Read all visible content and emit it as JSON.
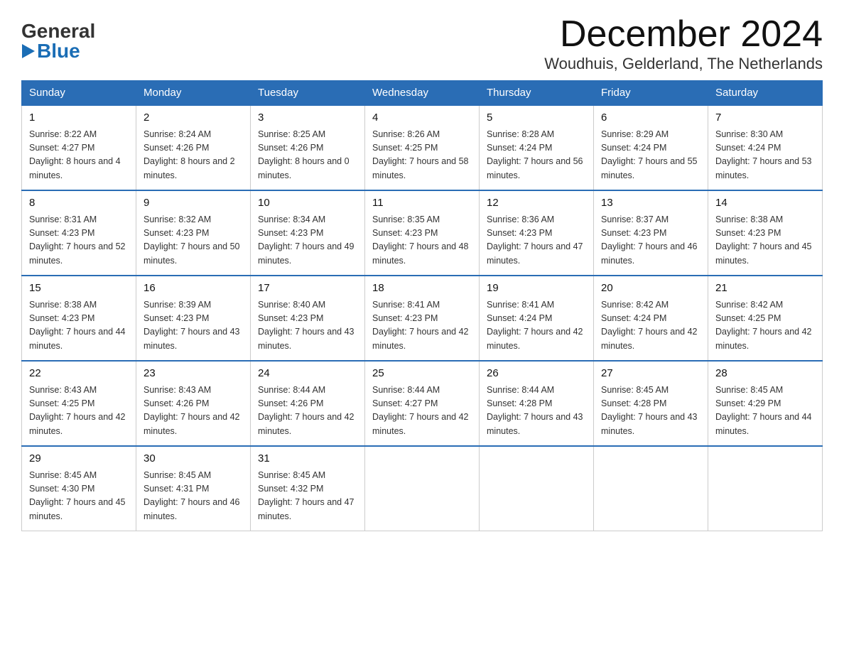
{
  "logo": {
    "general": "General",
    "blue": "Blue",
    "triangle_label": "logo-triangle"
  },
  "header": {
    "month_title": "December 2024",
    "location": "Woudhuis, Gelderland, The Netherlands"
  },
  "weekdays": [
    "Sunday",
    "Monday",
    "Tuesday",
    "Wednesday",
    "Thursday",
    "Friday",
    "Saturday"
  ],
  "weeks": [
    [
      {
        "day": "1",
        "sunrise": "8:22 AM",
        "sunset": "4:27 PM",
        "daylight": "8 hours and 4 minutes."
      },
      {
        "day": "2",
        "sunrise": "8:24 AM",
        "sunset": "4:26 PM",
        "daylight": "8 hours and 2 minutes."
      },
      {
        "day": "3",
        "sunrise": "8:25 AM",
        "sunset": "4:26 PM",
        "daylight": "8 hours and 0 minutes."
      },
      {
        "day": "4",
        "sunrise": "8:26 AM",
        "sunset": "4:25 PM",
        "daylight": "7 hours and 58 minutes."
      },
      {
        "day": "5",
        "sunrise": "8:28 AM",
        "sunset": "4:24 PM",
        "daylight": "7 hours and 56 minutes."
      },
      {
        "day": "6",
        "sunrise": "8:29 AM",
        "sunset": "4:24 PM",
        "daylight": "7 hours and 55 minutes."
      },
      {
        "day": "7",
        "sunrise": "8:30 AM",
        "sunset": "4:24 PM",
        "daylight": "7 hours and 53 minutes."
      }
    ],
    [
      {
        "day": "8",
        "sunrise": "8:31 AM",
        "sunset": "4:23 PM",
        "daylight": "7 hours and 52 minutes."
      },
      {
        "day": "9",
        "sunrise": "8:32 AM",
        "sunset": "4:23 PM",
        "daylight": "7 hours and 50 minutes."
      },
      {
        "day": "10",
        "sunrise": "8:34 AM",
        "sunset": "4:23 PM",
        "daylight": "7 hours and 49 minutes."
      },
      {
        "day": "11",
        "sunrise": "8:35 AM",
        "sunset": "4:23 PM",
        "daylight": "7 hours and 48 minutes."
      },
      {
        "day": "12",
        "sunrise": "8:36 AM",
        "sunset": "4:23 PM",
        "daylight": "7 hours and 47 minutes."
      },
      {
        "day": "13",
        "sunrise": "8:37 AM",
        "sunset": "4:23 PM",
        "daylight": "7 hours and 46 minutes."
      },
      {
        "day": "14",
        "sunrise": "8:38 AM",
        "sunset": "4:23 PM",
        "daylight": "7 hours and 45 minutes."
      }
    ],
    [
      {
        "day": "15",
        "sunrise": "8:38 AM",
        "sunset": "4:23 PM",
        "daylight": "7 hours and 44 minutes."
      },
      {
        "day": "16",
        "sunrise": "8:39 AM",
        "sunset": "4:23 PM",
        "daylight": "7 hours and 43 minutes."
      },
      {
        "day": "17",
        "sunrise": "8:40 AM",
        "sunset": "4:23 PM",
        "daylight": "7 hours and 43 minutes."
      },
      {
        "day": "18",
        "sunrise": "8:41 AM",
        "sunset": "4:23 PM",
        "daylight": "7 hours and 42 minutes."
      },
      {
        "day": "19",
        "sunrise": "8:41 AM",
        "sunset": "4:24 PM",
        "daylight": "7 hours and 42 minutes."
      },
      {
        "day": "20",
        "sunrise": "8:42 AM",
        "sunset": "4:24 PM",
        "daylight": "7 hours and 42 minutes."
      },
      {
        "day": "21",
        "sunrise": "8:42 AM",
        "sunset": "4:25 PM",
        "daylight": "7 hours and 42 minutes."
      }
    ],
    [
      {
        "day": "22",
        "sunrise": "8:43 AM",
        "sunset": "4:25 PM",
        "daylight": "7 hours and 42 minutes."
      },
      {
        "day": "23",
        "sunrise": "8:43 AM",
        "sunset": "4:26 PM",
        "daylight": "7 hours and 42 minutes."
      },
      {
        "day": "24",
        "sunrise": "8:44 AM",
        "sunset": "4:26 PM",
        "daylight": "7 hours and 42 minutes."
      },
      {
        "day": "25",
        "sunrise": "8:44 AM",
        "sunset": "4:27 PM",
        "daylight": "7 hours and 42 minutes."
      },
      {
        "day": "26",
        "sunrise": "8:44 AM",
        "sunset": "4:28 PM",
        "daylight": "7 hours and 43 minutes."
      },
      {
        "day": "27",
        "sunrise": "8:45 AM",
        "sunset": "4:28 PM",
        "daylight": "7 hours and 43 minutes."
      },
      {
        "day": "28",
        "sunrise": "8:45 AM",
        "sunset": "4:29 PM",
        "daylight": "7 hours and 44 minutes."
      }
    ],
    [
      {
        "day": "29",
        "sunrise": "8:45 AM",
        "sunset": "4:30 PM",
        "daylight": "7 hours and 45 minutes."
      },
      {
        "day": "30",
        "sunrise": "8:45 AM",
        "sunset": "4:31 PM",
        "daylight": "7 hours and 46 minutes."
      },
      {
        "day": "31",
        "sunrise": "8:45 AM",
        "sunset": "4:32 PM",
        "daylight": "7 hours and 47 minutes."
      },
      null,
      null,
      null,
      null
    ]
  ],
  "labels": {
    "sunrise_prefix": "Sunrise: ",
    "sunset_prefix": "Sunset: ",
    "daylight_prefix": "Daylight: "
  }
}
